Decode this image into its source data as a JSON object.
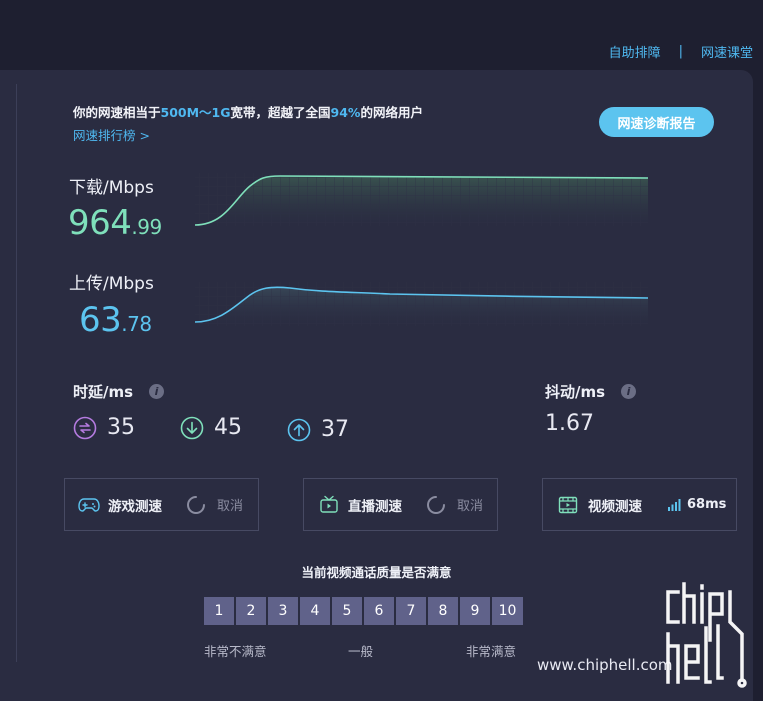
{
  "header": {
    "links": [
      {
        "label": "自助排障"
      },
      {
        "label": "网速课堂"
      }
    ],
    "separator": "|"
  },
  "summary": {
    "prefix": "你的网速相当于",
    "bandwidth": "500M～1G",
    "mid": "宽带，超越了全国",
    "percent": "94%",
    "suffix": "的网络用户",
    "rank_link": "网速排行榜 >"
  },
  "diagnose_button": "网速诊断报告",
  "download": {
    "label": "下载/Mbps",
    "value_int": "964",
    "value_dec": ".99",
    "color": "#7fe0bb"
  },
  "upload": {
    "label": "上传/Mbps",
    "value_int": "63",
    "value_dec": ".78",
    "color": "#5cc4ef"
  },
  "latency": {
    "label": "时延/ms",
    "items": [
      {
        "icon": "swap-icon",
        "value": "35",
        "color": "#b57be0"
      },
      {
        "icon": "arrow-down-circle-icon",
        "value": "45",
        "color": "#7fe0bb"
      },
      {
        "icon": "arrow-up-circle-icon",
        "value": "37",
        "color": "#5cc4ef"
      }
    ]
  },
  "jitter": {
    "label": "抖动/ms",
    "value": "1.67"
  },
  "tests": {
    "game": {
      "label": "游戏测速",
      "cancel": "取消"
    },
    "live": {
      "label": "直播测速",
      "cancel": "取消"
    },
    "video": {
      "label": "视频测速",
      "result": "68ms"
    }
  },
  "survey": {
    "title": "当前视频通话质量是否满意",
    "options": [
      "1",
      "2",
      "3",
      "4",
      "5",
      "6",
      "7",
      "8",
      "9",
      "10"
    ],
    "low_label": "非常不满意",
    "mid_label": "一般",
    "high_label": "非常满意"
  },
  "watermark": {
    "text": "www.chiphell.com"
  }
}
